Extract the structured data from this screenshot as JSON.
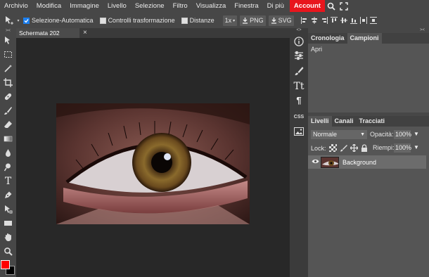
{
  "menubar": {
    "items": [
      "Archivio",
      "Modifica",
      "Immagine",
      "Livello",
      "Selezione",
      "Filtro",
      "Visualizza",
      "Finestra",
      "Di più"
    ],
    "account_label": "Account",
    "icons": [
      "search-icon",
      "fullscreen-icon"
    ],
    "account_color": "#e8161d"
  },
  "options": {
    "auto_select_label": "Selezione-Automatica",
    "auto_select_checked": true,
    "transform_label": "Controlli trasformazione",
    "distances_label": "Distanze",
    "zoom_value": "1x",
    "png_label": "PNG",
    "svg_label": "SVG"
  },
  "document": {
    "tab_title": "Schermata 202",
    "close_symbol": "×"
  },
  "colors": {
    "foreground": "#ff0000",
    "background": "#000000",
    "accent": "#1b7ff0"
  },
  "strip": {
    "css_label": "CSS"
  },
  "history_panel": {
    "tabs": [
      "Cronologia",
      "Campioni"
    ],
    "items": [
      "Apri"
    ]
  },
  "layers_panel": {
    "tabs": [
      "Livelli",
      "Canali",
      "Tracciati"
    ],
    "blend_mode": "Normale",
    "opacity_label": "Opacità:",
    "opacity_value": "100%",
    "lock_label": "Lock:",
    "fill_label": "Riempi:",
    "fill_value": "100%",
    "layers": [
      {
        "name": "Background"
      }
    ]
  }
}
